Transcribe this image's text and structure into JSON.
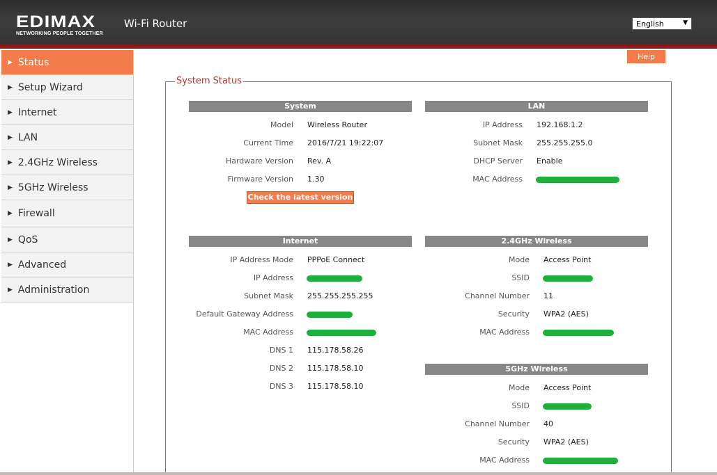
{
  "header": {
    "logo": "EDIMAX",
    "logo_tagline": "NETWORKING PEOPLE TOGETHER",
    "title": "Wi-Fi Router",
    "language": "English",
    "colors": {
      "header_bg": "#333333",
      "accent_line": "#8a1a1a"
    }
  },
  "sidebar": {
    "items": [
      {
        "label": "Status",
        "active": true
      },
      {
        "label": "Setup Wizard"
      },
      {
        "label": "Internet"
      },
      {
        "label": "LAN"
      },
      {
        "label": "2.4GHz Wireless"
      },
      {
        "label": "5GHz Wireless"
      },
      {
        "label": "Firewall"
      },
      {
        "label": "QoS"
      },
      {
        "label": "Advanced"
      },
      {
        "label": "Administration"
      }
    ]
  },
  "help_label": "Help",
  "system_status": {
    "legend": "System Status",
    "system": {
      "heading": "System",
      "rows": [
        {
          "label": "Model",
          "value": "Wireless Router"
        },
        {
          "label": "Current Time",
          "value": "2016/7/21  19:22:07"
        },
        {
          "label": "Hardware Version",
          "value": "Rev. A"
        },
        {
          "label": "Firmware Version",
          "value": "1.30"
        }
      ],
      "check_button": "Check the latest version"
    },
    "lan": {
      "heading": "LAN",
      "rows": [
        {
          "label": "IP Address",
          "value": "192.168.1.2"
        },
        {
          "label": "Subnet Mask",
          "value": "255.255.255.0"
        },
        {
          "label": "DHCP Server",
          "value": "Enable"
        },
        {
          "label": "MAC Address",
          "value": ""
        }
      ]
    },
    "internet": {
      "heading": "Internet",
      "rows": [
        {
          "label": "IP Address Mode",
          "value": "PPPoE  Connect"
        },
        {
          "label": "IP Address",
          "value": ""
        },
        {
          "label": "Subnet Mask",
          "value": "255.255.255.255"
        },
        {
          "label": "Default Gateway Address",
          "value": ""
        },
        {
          "label": "MAC Address",
          "value": ""
        },
        {
          "label": "DNS 1",
          "value": "115.178.58.26"
        },
        {
          "label": "DNS 2",
          "value": "115.178.58.10"
        },
        {
          "label": "DNS 3",
          "value": "115.178.58.10"
        }
      ]
    },
    "wireless24": {
      "heading": "2.4GHz  Wireless",
      "rows": [
        {
          "label": "Mode",
          "value": "Access Point"
        },
        {
          "label": "SSID",
          "value": ""
        },
        {
          "label": "Channel Number",
          "value": "11"
        },
        {
          "label": "Security",
          "value": "WPA2 (AES)"
        },
        {
          "label": "MAC Address",
          "value": ""
        }
      ]
    },
    "wireless5": {
      "heading": "5GHz  Wireless",
      "rows": [
        {
          "label": "Mode",
          "value": "Access Point"
        },
        {
          "label": "SSID",
          "value": ""
        },
        {
          "label": "Channel Number",
          "value": "40"
        },
        {
          "label": "Security",
          "value": "WPA2 (AES)"
        },
        {
          "label": "MAC Address",
          "value": ""
        }
      ]
    }
  }
}
